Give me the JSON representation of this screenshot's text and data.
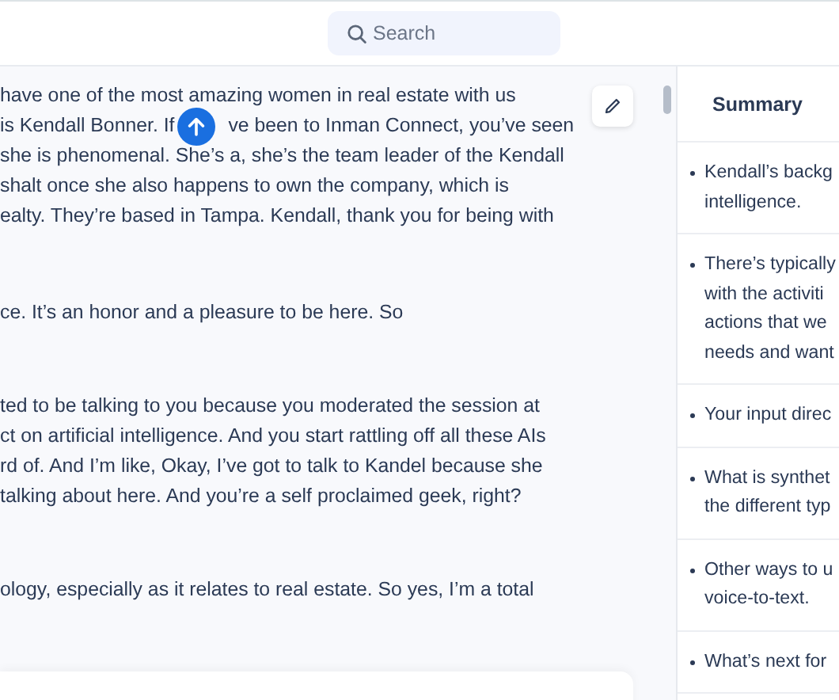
{
  "search": {
    "placeholder": "Search"
  },
  "transcript": [
    {
      "lines": [
        {
          "text": "have one of the most amazing women in real estate with us"
        },
        {
          "text": "is Kendall Bonner. If",
          "after": "ve been to Inman Connect, you’ve seen"
        },
        {
          "text": "she is phenomenal. She’s a, she’s the team leader of the Kendall"
        },
        {
          "text": "shalt once she also happens to own the company, which is"
        },
        {
          "text": "ealty. They’re based in Tampa. Kendall, thank you for being with"
        }
      ]
    },
    {
      "lines": [
        {
          "text": "ce. It’s an honor and a pleasure to be here. So"
        }
      ]
    },
    {
      "lines": [
        {
          "text": "ted to be talking to you because you moderated the session at"
        },
        {
          "text": "ct on artificial intelligence. And you start rattling off all these AIs"
        },
        {
          "text": "rd of. And I’m like, Okay, I’ve got to talk to Kandel because she"
        },
        {
          "text": "talking about here. And you’re a self proclaimed geek, right?"
        }
      ]
    },
    {
      "lines": [
        {
          "text": "ology, especially as it relates to real estate. So yes, I’m a total"
        }
      ]
    }
  ],
  "summary": {
    "title": "Summary",
    "items": [
      {
        "lines": [
          "Kendall’s backg",
          "intelligence."
        ]
      },
      {
        "lines": [
          "There’s typically",
          "with the activiti",
          "actions that we",
          "needs and want"
        ]
      },
      {
        "lines": [
          "Your input direc"
        ]
      },
      {
        "lines": [
          "What is synthet",
          "the different typ"
        ]
      },
      {
        "lines": [
          "Other ways to u",
          "voice-to-text."
        ]
      },
      {
        "lines": [
          "What’s next for"
        ]
      }
    ]
  }
}
